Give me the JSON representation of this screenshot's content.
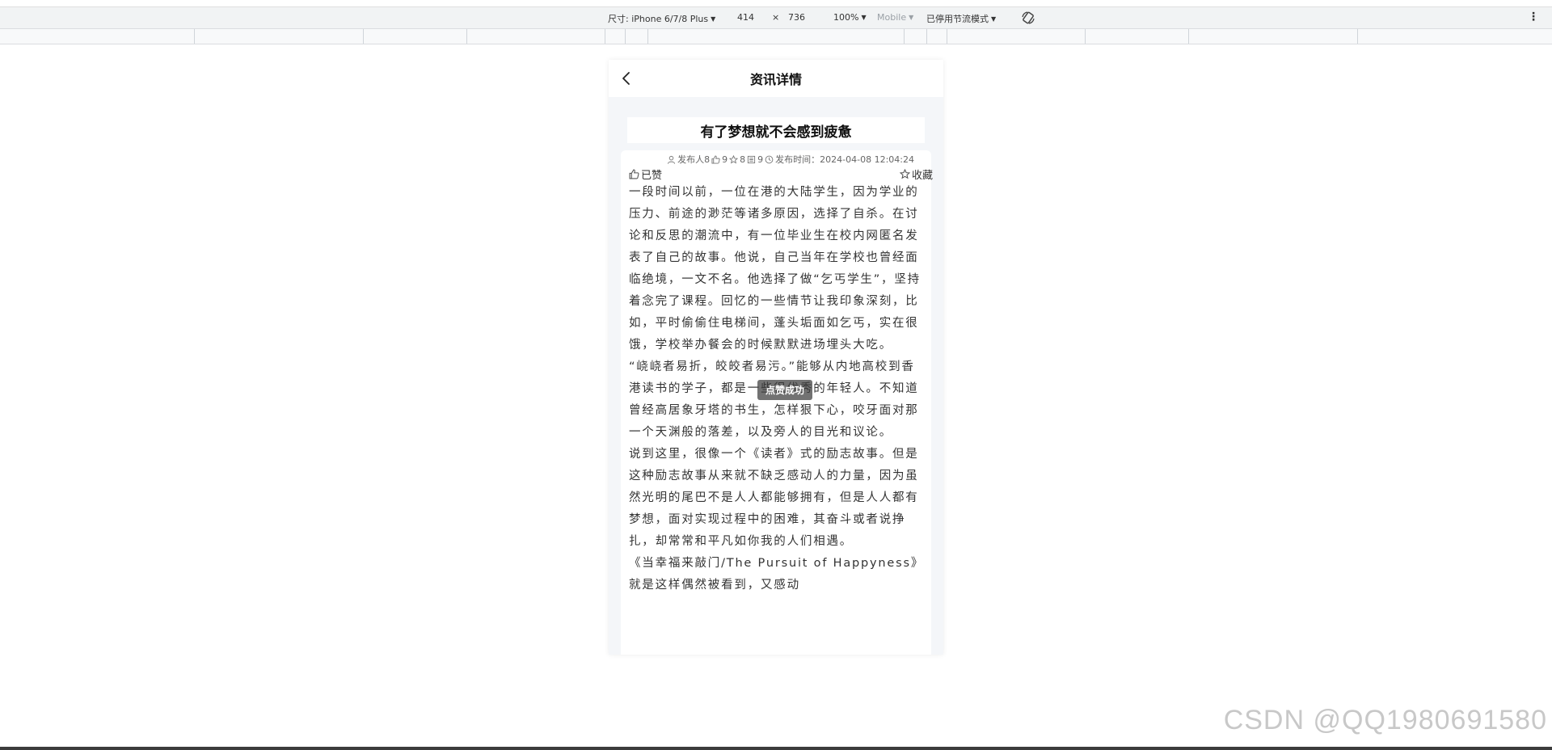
{
  "devtools": {
    "dimensions_label": "尺寸: iPhone 6/7/8 Plus",
    "width": "414",
    "times": "×",
    "height": "736",
    "zoom": "100%",
    "device_type": "Mobile",
    "throttle": "已停用节流模式",
    "more_icon": "⋮"
  },
  "navbar": {
    "title": "资讯详情"
  },
  "article": {
    "title": "有了梦想就不会感到疲惫",
    "meta": {
      "publisher": "发布人8",
      "likes": "9",
      "favorites": "8",
      "views": "9",
      "publish_time": "发布时间：2024-04-08 12:04:24"
    },
    "like_label": "已赞",
    "favorite_label": "收藏",
    "paragraphs": [
      "一段时间以前，一位在港的大陆学生，因为学业的压力、前途的渺茫等诸多原因，选择了自杀。在讨论和反思的潮流中，有一位毕业生在校内网匿名发表了自己的故事。他说，自己当年在学校也曾经面临绝境，一文不名。他选择了做“乞丐学生”，坚持着念完了课程。回忆的一些情节让我印象深刻，比如，平时偷偷住电梯间，蓬头垢面如乞丐，实在很饿，学校举办餐会的时候默默进场埋头大吃。",
      "“峣峣者易折，皎皎者易污。”能够从内地高校到香港读书的学子，都是一些很优秀的年轻人。不知道曾经高居象牙塔的书生，怎样狠下心，咬牙面对那一个天渊般的落差，以及旁人的目光和议论。",
      "说到这里，很像一个《读者》式的励志故事。但是这种励志故事从来就不缺乏感动人的力量，因为虽然光明的尾巴不是人人都能够拥有，但是人人都有梦想，面对实现过程中的困难，其奋斗或者说挣扎，却常常和平凡如你我的人们相遇。",
      "《当幸福来敲门/The Pursuit of Happyness》就是这样偶然被看到，又感动"
    ]
  },
  "toast": "点赞成功",
  "watermark": "CSDN @QQ1980691580"
}
